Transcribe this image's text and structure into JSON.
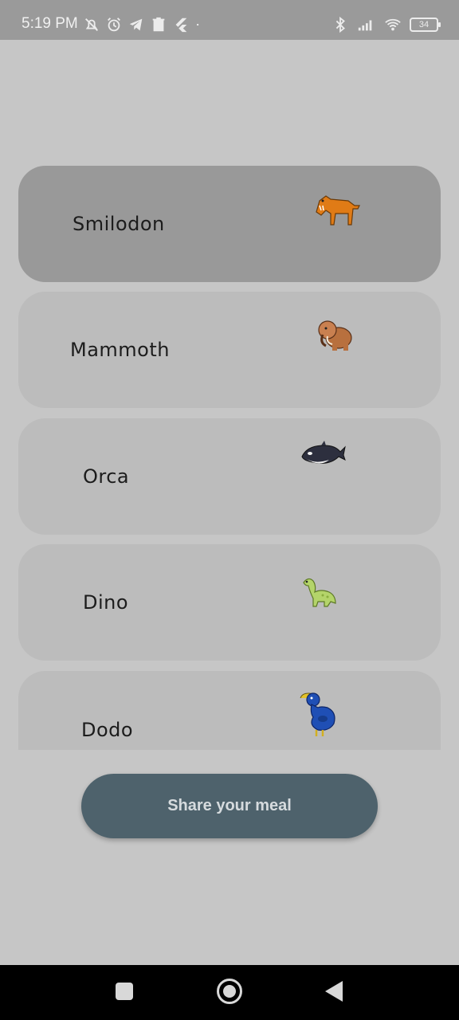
{
  "status_bar": {
    "time": "5:19 PM",
    "battery": "34",
    "left_icons": [
      "mute-bell-icon",
      "alarm-icon",
      "telegram-icon",
      "trash-icon",
      "flutter-icon",
      "dot-icon"
    ],
    "right_icons": [
      "bluetooth-icon",
      "signal-icon",
      "wifi-icon",
      "battery-icon"
    ]
  },
  "animals": [
    {
      "label": "Smilodon",
      "icon": "smilodon-icon",
      "selected": true
    },
    {
      "label": "Mammoth",
      "icon": "mammoth-icon",
      "selected": false
    },
    {
      "label": "Orca",
      "icon": "orca-icon",
      "selected": false
    },
    {
      "label": "Dino",
      "icon": "dino-icon",
      "selected": false
    },
    {
      "label": "Dodo",
      "icon": "dodo-icon",
      "selected": false
    }
  ],
  "share_button": {
    "label": "Share your meal"
  },
  "nav_bar": {
    "items": [
      "recents-icon",
      "home-icon",
      "back-icon"
    ]
  },
  "colors": {
    "background": "#c6c6c6",
    "card": "#bcbcbc",
    "card_selected": "#999999",
    "button": "#4e626c",
    "button_text": "#d6dbde"
  }
}
